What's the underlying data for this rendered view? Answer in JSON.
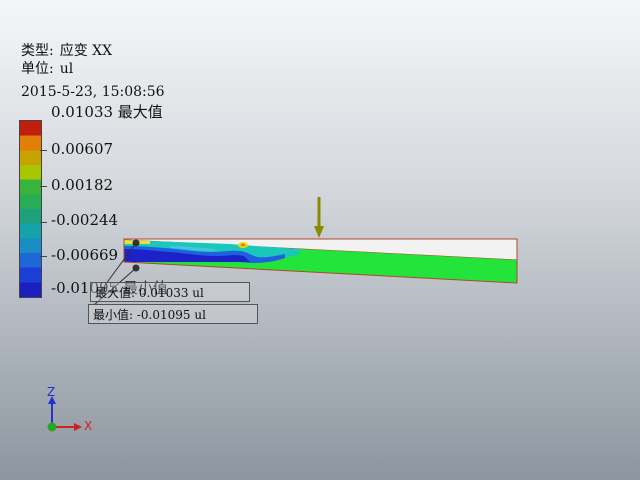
{
  "info": {
    "type_key": "类型:",
    "type_value": "应变 XX",
    "unit_key": "单位:",
    "unit_value": "ul",
    "datetime": "2015-5-23, 15:08:56"
  },
  "legend": {
    "max_label": "0.01033 最大值",
    "ticks": [
      "0.00607",
      "0.00182",
      "-0.00244",
      "-0.00669"
    ],
    "min_label": "-0.01095 最小值",
    "colors": [
      "#c21e0c",
      "#e37e0a",
      "#c6a300",
      "#a9c700",
      "#39b33c",
      "#27ad55",
      "#1ea07c",
      "#13a3a8",
      "#1a8dc4",
      "#1d68d6",
      "#1b3fd6",
      "#1a1fc0"
    ]
  },
  "callouts": {
    "max": "最大值: 0.01033 ul",
    "min": "最小值: -0.01095 ul"
  },
  "triad": {
    "z": "Z",
    "x": "X"
  },
  "colors": {
    "beam_green": "#22e43a",
    "load_arrow": "#8a8a00",
    "beam_outline": "#b5452c"
  }
}
